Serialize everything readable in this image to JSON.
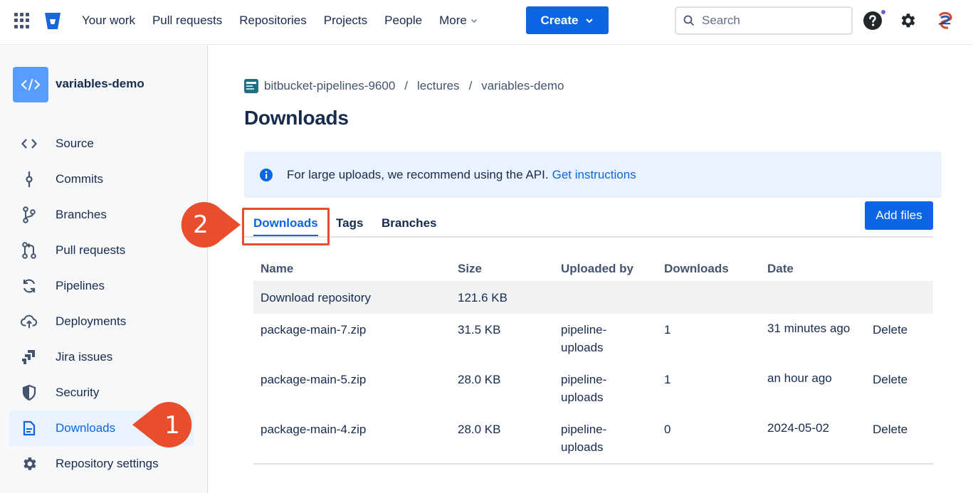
{
  "topbar": {
    "nav": [
      "Your work",
      "Pull requests",
      "Repositories",
      "Projects",
      "People"
    ],
    "more_label": "More",
    "create_label": "Create",
    "search_placeholder": "Search"
  },
  "sidebar": {
    "repo_name": "variables-demo",
    "items": [
      {
        "label": "Source",
        "icon": "code-icon"
      },
      {
        "label": "Commits",
        "icon": "commit-icon"
      },
      {
        "label": "Branches",
        "icon": "branch-icon"
      },
      {
        "label": "Pull requests",
        "icon": "pull-request-icon"
      },
      {
        "label": "Pipelines",
        "icon": "pipelines-icon"
      },
      {
        "label": "Deployments",
        "icon": "cloud-upload-icon"
      },
      {
        "label": "Jira issues",
        "icon": "jira-icon"
      },
      {
        "label": "Security",
        "icon": "shield-icon"
      },
      {
        "label": "Downloads",
        "icon": "document-icon",
        "active": true
      },
      {
        "label": "Repository settings",
        "icon": "gear-icon"
      }
    ]
  },
  "breadcrumb": {
    "workspace": "bitbucket-pipelines-9600",
    "project": "lectures",
    "repo": "variables-demo",
    "separator": "/"
  },
  "main": {
    "title": "Downloads",
    "banner_text": "For large uploads, we recommend using the API.",
    "banner_link": "Get instructions",
    "tabs": [
      "Downloads",
      "Tags",
      "Branches"
    ],
    "add_files_label": "Add files",
    "columns": [
      "Name",
      "Size",
      "Uploaded by",
      "Downloads",
      "Date"
    ],
    "rows": [
      {
        "name": "Download repository",
        "size": "121.6 KB",
        "uploaded_by_1": "",
        "uploaded_by_2": "",
        "downloads": "",
        "date": "",
        "action": ""
      },
      {
        "name": "package-main-7.zip",
        "size": "31.5 KB",
        "uploaded_by_1": "pipeline-",
        "uploaded_by_2": "uploads",
        "downloads": "1",
        "date": "31 minutes ago",
        "action": "Delete"
      },
      {
        "name": "package-main-5.zip",
        "size": "28.0 KB",
        "uploaded_by_1": "pipeline-",
        "uploaded_by_2": "uploads",
        "downloads": "1",
        "date": "an hour ago",
        "action": "Delete"
      },
      {
        "name": "package-main-4.zip",
        "size": "28.0 KB",
        "uploaded_by_1": "pipeline-",
        "uploaded_by_2": "uploads",
        "downloads": "0",
        "date": "2024-05-02",
        "action": "Delete"
      }
    ]
  },
  "callouts": {
    "first": "1",
    "second": "2",
    "color": "#e84e2c"
  },
  "colors": {
    "accent": "#0c66e4",
    "banner_bg": "#e9f2ff",
    "sidebar_bg": "#f7f8f9"
  }
}
